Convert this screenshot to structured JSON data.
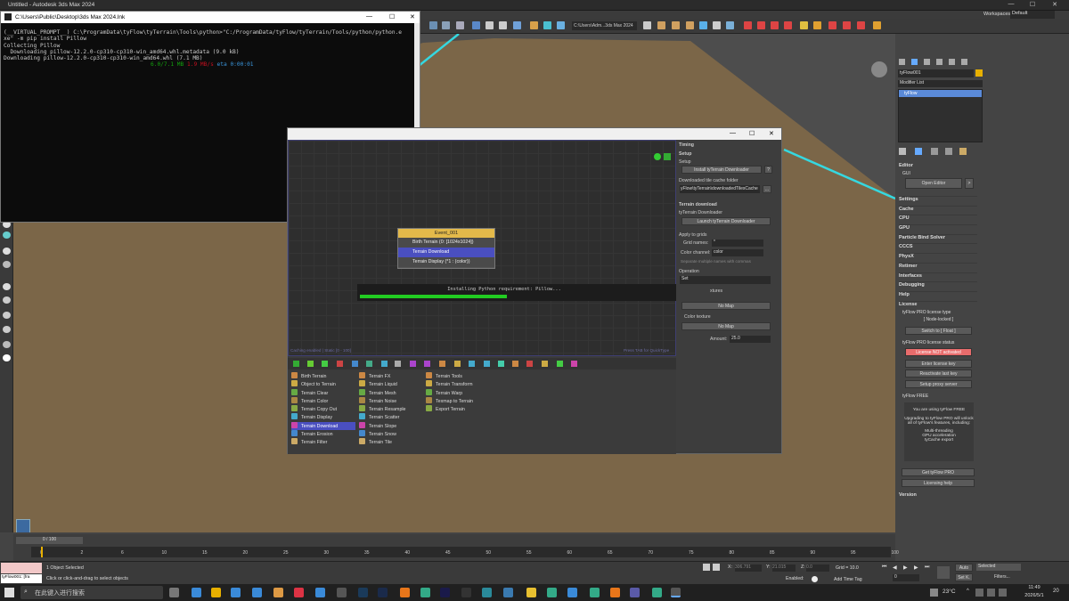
{
  "app": {
    "title": "Untitled - Autodesk 3ds Max 2024",
    "workspaces_label": "Workspaces:",
    "workspaces_value": "Default"
  },
  "toolbar": {
    "path_dropdown": "C:\\Users\\Adm...3ds Max 2024"
  },
  "cmd": {
    "title": "C:\\Users\\Public\\Desktop\\3ds Max 2024.lnk",
    "lines": [
      "(__VIRTUAL_PROMPT__) C:\\ProgramData\\tyFlow\\tyTerrain\\Tools\\python>\"C:/ProgramData/tyFlow/tyTerrain/Tools/python/python.e",
      "xe\" -m pip install Pillow",
      "Collecting Pillow",
      "  Downloading pillow-12.2.0-cp310-cp310-win_amd64.whl.metadata (9.0 kB)",
      "Downloading pillow-12.2.0-cp310-cp310-win_amd64.whl (7.1 MB)"
    ],
    "progress_done": "6.0/7.1 MB",
    "progress_rate": "1.9 MB/s",
    "progress_eta": "eta 0:00:01"
  },
  "tyflow": {
    "event_title": "Event_001",
    "operators": [
      "Birth Terrain (0: [1024x1024])",
      "Terrain Download",
      "Terrain Display (*1 : (color))"
    ],
    "install_text": "Installing Python requirement: Pillow...",
    "install_progress": 0.55,
    "caching_text": "Caching enabled | Static [0 - 100]",
    "hint_text": "Press TAB for QuickType",
    "op_col1": [
      "Birth Terrain",
      "Object to Terrain",
      "Terrain Clear",
      "Terrain Color",
      "Terrain Copy Out",
      "Terrain Display",
      "Terrain Download",
      "Terrain Erosion",
      "Terrain Filter"
    ],
    "op_col2": [
      "Terrain FX",
      "Terrain Liquid",
      "Terrain Mesh",
      "Terrain Noise",
      "Terrain Resample",
      "Terrain Scatter",
      "Terrain Slope",
      "Terrain Snow",
      "Terrain Tile"
    ],
    "op_col3": [
      "Terrain Tools",
      "Terrain Transform",
      "Terrain Warp",
      "Texmap to Terrain",
      "Export Terrain"
    ],
    "settings": {
      "timing": "Timing",
      "setup": "Setup",
      "setup_sub": "Setup",
      "install_btn": "Install tyTerrain Downloader",
      "q": "?",
      "cache_label": "Downloaded tile cache folder",
      "cache_path": "yFlow\\tyTerrain\\downloadedTilesCache",
      "browse": "...",
      "terrain_download": "Terrain download",
      "downloader_label": "tyTerrain Downloader",
      "launch_btn": "Launch tyTerrain Downloader",
      "apply_label": "Apply to grids",
      "grid_names_label": "Grid names:",
      "grid_names_value": "*",
      "color_channel_label": "Color channel:",
      "color_channel_value": "color",
      "separate_note": "Separate multiple names with commas",
      "operation_label": "Operation",
      "operation_value": "Set",
      "textures_label": "xtures",
      "no_map_1": "No Map",
      "color_texture": "Color texture",
      "no_map_2": "No Map",
      "amount_label": "Amount:",
      "amount_value": "25.0"
    }
  },
  "right_panel": {
    "object_name": "tyFlow001",
    "modifier_list": "Modifier List",
    "modifier_item": "tyFlow",
    "editor": "Editor",
    "gui": "GUI",
    "open_editor": "Open Editor",
    "arrow": ">",
    "sections": [
      "Settings",
      "Cache",
      "CPU",
      "GPU",
      "Particle Bind Solver",
      "CCCS",
      "PhysX",
      "Retimer",
      "Interfaces",
      "Debugging",
      "Help",
      "License"
    ],
    "license_type_label": "tyFlow PRO license type",
    "node_locked": "[ Node-locked ]",
    "switch_float": "Switch to [ Float ]",
    "license_status_label": "tyFlow PRO license status",
    "license_status": "License NOT activated",
    "enter_key": "Enter license key",
    "reactivate": "Reactivate last key",
    "proxy": "Setup proxy server",
    "free_label": "tyFlow FREE",
    "free_text_1": "You are using tyFlow FREE",
    "free_text_2": "Upgrading to tyFlow PRO will unlock all of tyFlow's features, including:",
    "free_text_3": "Multi-threading",
    "free_text_4": "GPU acceleration",
    "free_text_5": "tyCache export",
    "get_pro": "Get tyFlow PRO",
    "licensing_help": "Licensing help",
    "version": "Version"
  },
  "timeline": {
    "frame": "0 / 100",
    "ticks": [
      "0",
      "2",
      "6",
      "10",
      "15",
      "20",
      "25",
      "30",
      "35",
      "40",
      "45",
      "50",
      "55",
      "60",
      "65",
      "70",
      "75",
      "80",
      "85",
      "90",
      "95",
      "100"
    ]
  },
  "status": {
    "selected": "1 Object Selected",
    "hint": "Click or click-and-drag to select objects",
    "listener": "tyFlow001: [fra",
    "x_label": "X:",
    "x_value": "306.791",
    "y_label": "Y:",
    "y_value": "21.015",
    "z_label": "Z:",
    "z_value": "0.0",
    "grid": "Grid = 10.0",
    "enabled": "Enabled:",
    "add_time_tag": "Add Time Tag",
    "auto": "Auto",
    "set_k": "Set K.",
    "selected_dd": "Selected",
    "filters": "Filters...",
    "frame_field": "0"
  },
  "taskbar": {
    "search_placeholder": "在此键入进行搜索",
    "weather": "23°C",
    "time": "11:49",
    "date": "2026/5/1",
    "notif": "20"
  },
  "colors": {
    "terrain": "#7b6648",
    "edge": "#35d8e0",
    "progress": "#22cc22",
    "selected_op": "#4a4fc0",
    "event_header": "#e3b94a",
    "license_bad": "#e86c6c"
  }
}
